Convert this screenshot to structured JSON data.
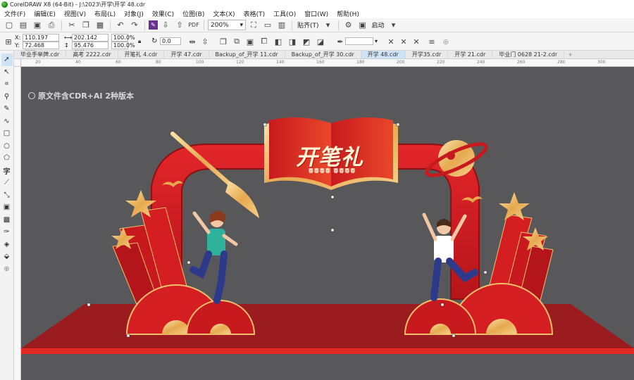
{
  "window": {
    "title": "CorelDRAW X8 (64-Bit) - J:\\2023\\开学\\开学 48.cdr"
  },
  "menu": [
    "文件(F)",
    "编辑(E)",
    "视图(V)",
    "布局(L)",
    "对象(J)",
    "效果(C)",
    "位图(B)",
    "文本(X)",
    "表格(T)",
    "工具(O)",
    "窗口(W)",
    "帮助(H)"
  ],
  "toolbar": {
    "zoom_value": "200%",
    "snap_label": "贴齐(T)",
    "launch_label": "启动",
    "icons": [
      "new-icon",
      "open-icon",
      "save-icon",
      "print-icon",
      "cut-icon",
      "copy-icon",
      "paste-icon",
      "undo-icon",
      "redo-icon",
      "search-content-icon",
      "import-icon",
      "export-icon",
      "publish-pdf-icon",
      "zoom-page-icon",
      "full-screen-icon",
      "rulers-icon",
      "options-icon",
      "launch-icon"
    ]
  },
  "property_bar": {
    "x": "110.197 mm",
    "y": "72.468 mm",
    "width": "202.142 mm",
    "height": "95.476 mm",
    "scale_x": "100.0",
    "scale_y": "100.0",
    "percent": "%",
    "rotation": "0.0",
    "x_label": "X:",
    "y_label": "Y:"
  },
  "tabs": [
    {
      "label": "毕业手举牌.cdr",
      "active": false
    },
    {
      "label": "高考 2222.cdr",
      "active": false
    },
    {
      "label": "开笔礼 4.cdr",
      "active": false
    },
    {
      "label": "开学 47.cdr",
      "active": false
    },
    {
      "label": "Backup_of_开学 11.cdr",
      "active": false
    },
    {
      "label": "Backup_of_开学 30.cdr",
      "active": false
    },
    {
      "label": "开学 48.cdr",
      "active": true
    },
    {
      "label": "开学35.cdr",
      "active": false
    },
    {
      "label": "开学 21.cdr",
      "active": false
    },
    {
      "label": "毕业门 0628 21-2.cdr",
      "active": false
    }
  ],
  "tools": [
    "pick-tool-icon",
    "shape-tool-icon",
    "crop-tool-icon",
    "zoom-tool-icon",
    "freehand-tool-icon",
    "artistic-media-icon",
    "rectangle-tool-icon",
    "ellipse-tool-icon",
    "polygon-tool-icon",
    "text-tool-icon",
    "parallel-dimension-icon",
    "connector-tool-icon",
    "drop-shadow-icon",
    "transparency-icon",
    "eyedropper-icon",
    "interactive-fill-icon",
    "smart-fill-icon",
    "add-tool-icon"
  ],
  "ruler_ticks": [
    "20",
    "40",
    "60",
    "80",
    "100",
    "120",
    "140",
    "160",
    "180",
    "200",
    "220",
    "240",
    "260",
    "280",
    "300"
  ],
  "artwork": {
    "watermark": "原文件含CDR+AI 2种版本",
    "title": "开笔礼",
    "subtitle": "春春春春  春春春春"
  },
  "colors": {
    "canvas_bg": "#58575a",
    "arch_red": "#d41e22",
    "dark_red": "#9e1518",
    "gold": "#f2c06c",
    "stage_red": "#9b1c1e",
    "stage_edge": "#e22a22"
  }
}
